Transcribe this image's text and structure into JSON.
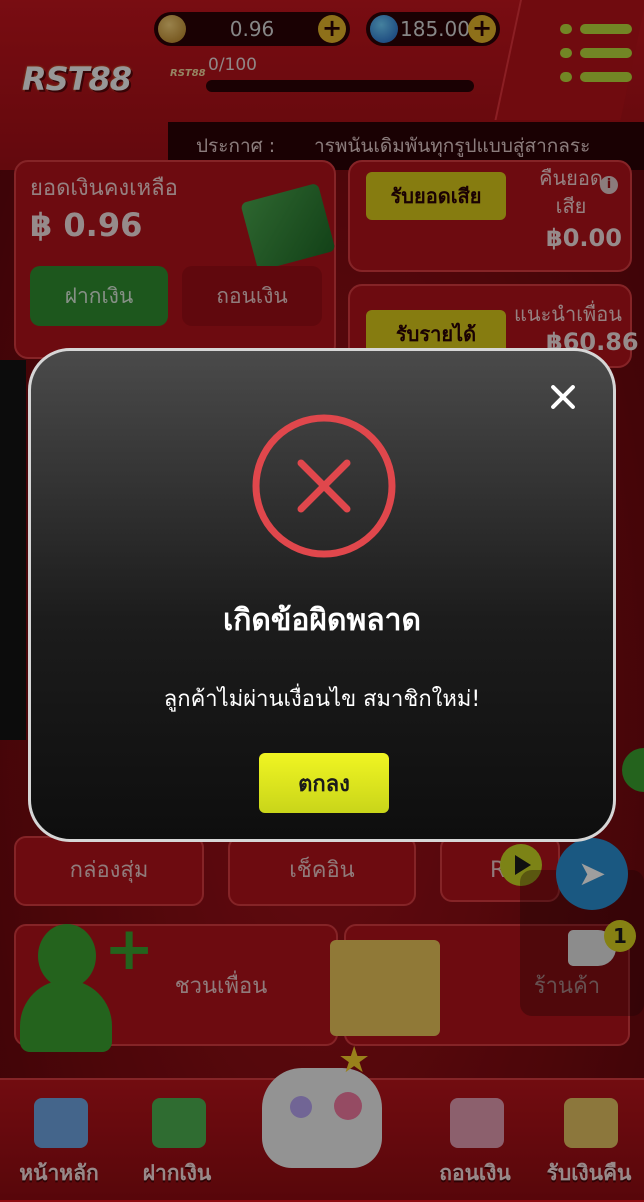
{
  "header": {
    "logo": "RST88",
    "logo_small": "RST88",
    "coin_balance": "0.96",
    "gem_balance": "185.00",
    "progress_text": "0/100",
    "announce_label": "ประกาศ :",
    "announce_text": "ารพนันเดิมพันทุกรูปแบบสู่สากลระ"
  },
  "balance_card": {
    "title": "ยอดเงินคงเหลือ",
    "amount": "฿ 0.96",
    "deposit_label": "ฝากเงิน",
    "withdraw_label": "ถอนเงิน"
  },
  "loss_card": {
    "button_label": "รับยอดเสีย",
    "label": "คืนยอดเสีย",
    "value": "฿0.00"
  },
  "referral_card": {
    "button_label": "รับรายได้",
    "label": "แนะนำเพื่อน",
    "value": "฿60.86"
  },
  "tiles": {
    "random_box": "กล่องสุ่ม",
    "checkin": "เช็คอิน",
    "recommend": "Rec",
    "invite": "ชวนเพื่อน",
    "shop": "ร้านค้า"
  },
  "notification_count": "1",
  "bottom_nav": {
    "home": "หน้าหลัก",
    "deposit": "ฝากเงิน",
    "withdraw": "ถอนเงิน",
    "cashback": "รับเงินคืน"
  },
  "modal": {
    "title": "เกิดข้อผิดพลาด",
    "message": "ลูกค้าไม่ผ่านเงื่อนไข สมาชิกใหม่!",
    "ok_label": "ตกลง"
  },
  "colors": {
    "error_red": "#e0474c",
    "ok_button": "#e2ea1f",
    "app_red": "#b1121a"
  }
}
